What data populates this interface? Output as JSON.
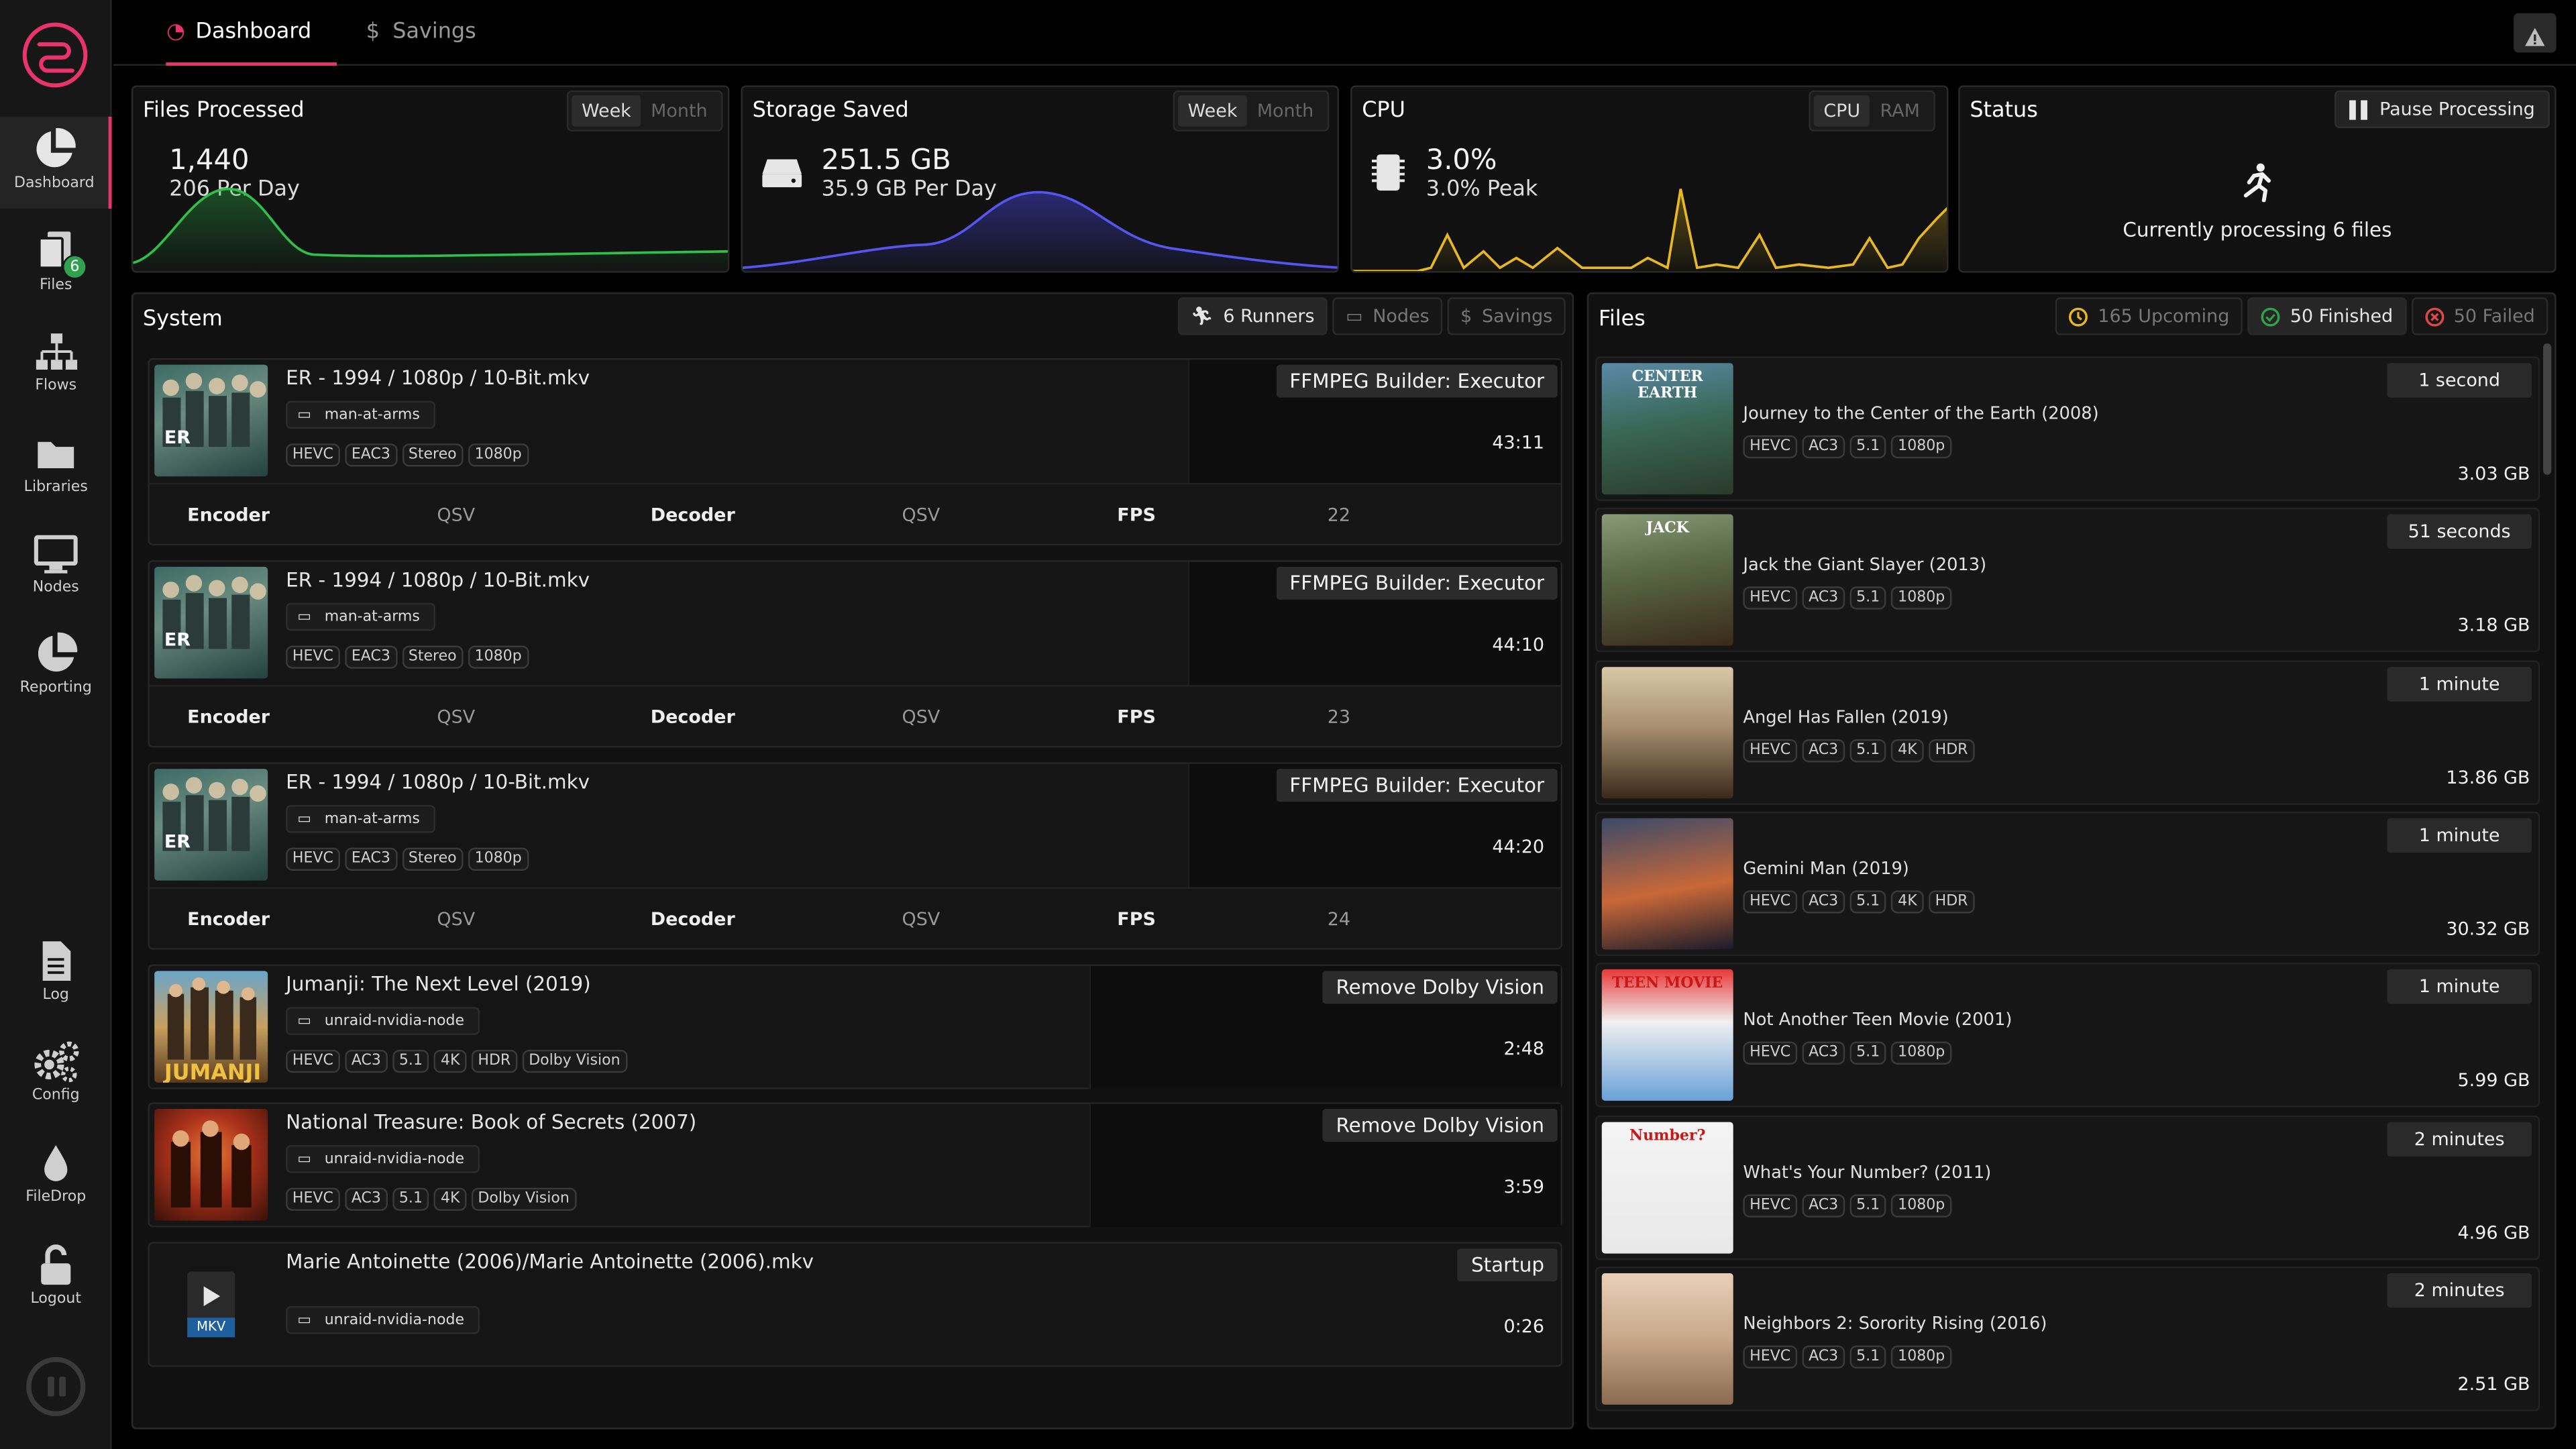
{
  "sidebar": {
    "items": [
      {
        "label": "Dashboard"
      },
      {
        "label": "Files",
        "badge": "6"
      },
      {
        "label": "Flows"
      },
      {
        "label": "Libraries"
      },
      {
        "label": "Nodes"
      },
      {
        "label": "Reporting"
      },
      {
        "label": "Log"
      },
      {
        "label": "Config"
      },
      {
        "label": "FileDrop"
      },
      {
        "label": "Logout"
      }
    ]
  },
  "tabs": [
    {
      "label": "Dashboard"
    },
    {
      "label": "Savings"
    }
  ],
  "widgets": {
    "files_processed": {
      "title": "Files Processed",
      "toggle": [
        "Week",
        "Month"
      ],
      "value": "1,440",
      "sub": "206 Per Day"
    },
    "storage_saved": {
      "title": "Storage Saved",
      "toggle": [
        "Week",
        "Month"
      ],
      "value": "251.5 GB",
      "sub": "35.9 GB Per Day"
    },
    "cpu": {
      "title": "CPU",
      "toggle": [
        "CPU",
        "RAM"
      ],
      "value": "3.0%",
      "sub": "3.0% Peak"
    },
    "status": {
      "title": "Status",
      "button": "Pause Processing",
      "message": "Currently processing 6 files"
    }
  },
  "system": {
    "title": "System",
    "buttons": [
      "6 Runners",
      "Nodes",
      "Savings"
    ],
    "runners": [
      {
        "title": "ER - 1994 / 1080p / 10-Bit.mkv",
        "node": "man-at-arms",
        "codecs": [
          "HEVC",
          "EAC3",
          "Stereo",
          "1080p"
        ],
        "flow": "FFMPEG Builder: Executor",
        "elapsed": "43:11",
        "encoder_label": "Encoder",
        "encoder": "QSV",
        "decoder_label": "Decoder",
        "decoder": "QSV",
        "fps_label": "FPS",
        "fps": "22"
      },
      {
        "title": "ER - 1994 / 1080p / 10-Bit.mkv",
        "node": "man-at-arms",
        "codecs": [
          "HEVC",
          "EAC3",
          "Stereo",
          "1080p"
        ],
        "flow": "FFMPEG Builder: Executor",
        "elapsed": "44:10",
        "encoder_label": "Encoder",
        "encoder": "QSV",
        "decoder_label": "Decoder",
        "decoder": "QSV",
        "fps_label": "FPS",
        "fps": "23"
      },
      {
        "title": "ER - 1994 / 1080p / 10-Bit.mkv",
        "node": "man-at-arms",
        "codecs": [
          "HEVC",
          "EAC3",
          "Stereo",
          "1080p"
        ],
        "flow": "FFMPEG Builder: Executor",
        "elapsed": "44:20",
        "encoder_label": "Encoder",
        "encoder": "QSV",
        "decoder_label": "Decoder",
        "decoder": "QSV",
        "fps_label": "FPS",
        "fps": "24"
      },
      {
        "title": "Jumanji: The Next Level (2019)",
        "node": "unraid-nvidia-node",
        "codecs": [
          "HEVC",
          "AC3",
          "5.1",
          "4K",
          "HDR",
          "Dolby Vision"
        ],
        "flow": "Remove Dolby Vision",
        "elapsed": "2:48"
      },
      {
        "title": "National Treasure: Book of Secrets (2007)",
        "node": "unraid-nvidia-node",
        "codecs": [
          "HEVC",
          "AC3",
          "5.1",
          "4K",
          "Dolby Vision"
        ],
        "flow": "Remove Dolby Vision",
        "elapsed": "3:59"
      },
      {
        "title": "Marie Antoinette (2006)/Marie Antoinette (2006).mkv",
        "node": "unraid-nvidia-node",
        "codecs": [],
        "flow": "Startup",
        "elapsed": "0:26",
        "ext": "MKV"
      }
    ]
  },
  "files": {
    "title": "Files",
    "filters": [
      "165 Upcoming",
      "50 Finished",
      "50 Failed"
    ],
    "items": [
      {
        "name": "Journey to the Center of the Earth (2008)",
        "codecs": [
          "HEVC",
          "AC3",
          "5.1",
          "1080p"
        ],
        "time": "1 second",
        "size": "3.03 GB",
        "poster_text": "CENTER EARTH"
      },
      {
        "name": "Jack the Giant Slayer (2013)",
        "codecs": [
          "HEVC",
          "AC3",
          "5.1",
          "1080p"
        ],
        "time": "51 seconds",
        "size": "3.18 GB",
        "poster_text": "JACK"
      },
      {
        "name": "Angel Has Fallen (2019)",
        "codecs": [
          "HEVC",
          "AC3",
          "5.1",
          "4K",
          "HDR"
        ],
        "time": "1 minute",
        "size": "13.86 GB",
        "poster_text": ""
      },
      {
        "name": "Gemini Man (2019)",
        "codecs": [
          "HEVC",
          "AC3",
          "5.1",
          "4K",
          "HDR"
        ],
        "time": "1 minute",
        "size": "30.32 GB",
        "poster_text": ""
      },
      {
        "name": "Not Another Teen Movie (2001)",
        "codecs": [
          "HEVC",
          "AC3",
          "5.1",
          "1080p"
        ],
        "time": "1 minute",
        "size": "5.99 GB",
        "poster_text": "TEEN MOVIE"
      },
      {
        "name": "What's Your Number? (2011)",
        "codecs": [
          "HEVC",
          "AC3",
          "5.1",
          "1080p"
        ],
        "time": "2 minutes",
        "size": "4.96 GB",
        "poster_text": "Number?"
      },
      {
        "name": "Neighbors 2: Sorority Rising (2016)",
        "codecs": [
          "HEVC",
          "AC3",
          "5.1",
          "1080p"
        ],
        "time": "2 minutes",
        "size": "2.51 GB",
        "poster_text": ""
      }
    ]
  },
  "colors": {
    "accent": "#e8336b",
    "files_chart": "#2fbf4a",
    "storage_chart": "#4848e8",
    "cpu_chart": "#e8b820",
    "finished": "#2fa14f",
    "failed": "#e04848",
    "upcoming": "#e8b820"
  }
}
